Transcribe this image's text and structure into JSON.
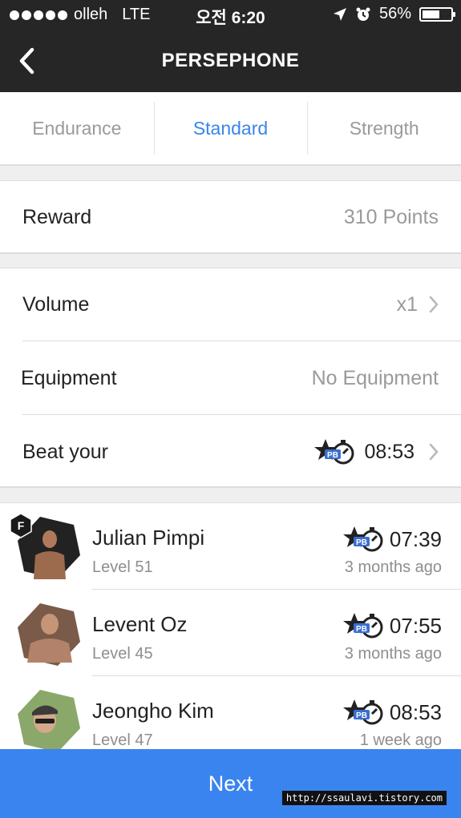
{
  "status_bar": {
    "carrier": "olleh",
    "network": "LTE",
    "time": "오전 6:20",
    "battery": "56%",
    "battery_level": 0.56
  },
  "nav": {
    "title": "PERSEPHONE",
    "back_icon": "chevron-left-icon"
  },
  "tabs": [
    {
      "label": "Endurance",
      "active": false
    },
    {
      "label": "Standard",
      "active": true
    },
    {
      "label": "Strength",
      "active": false
    }
  ],
  "reward": {
    "label": "Reward",
    "value": "310 Points"
  },
  "settings": {
    "volume": {
      "label": "Volume",
      "value": "x1"
    },
    "equipment": {
      "label": "Equipment",
      "value": "No Equipment"
    },
    "beat": {
      "label": "Beat your",
      "value": "08:53",
      "icon": "pb-stopwatch-icon"
    }
  },
  "leaderboard": [
    {
      "name": "Julian Pimpi",
      "level": "Level 51",
      "time": "07:39",
      "ago": "3 months ago",
      "badge": "F"
    },
    {
      "name": "Levent Oz",
      "level": "Level 45",
      "time": "07:55",
      "ago": "3 months ago"
    },
    {
      "name": "Jeongho Kim",
      "level": "Level 47",
      "time": "08:53",
      "ago": "1 week ago"
    }
  ],
  "next_button": "Next",
  "watermark": "http://ssaulavi.tistory.com",
  "colors": {
    "accent": "#3a84f0",
    "topbar": "#262626",
    "pb_badge": "#3a6fd0"
  }
}
